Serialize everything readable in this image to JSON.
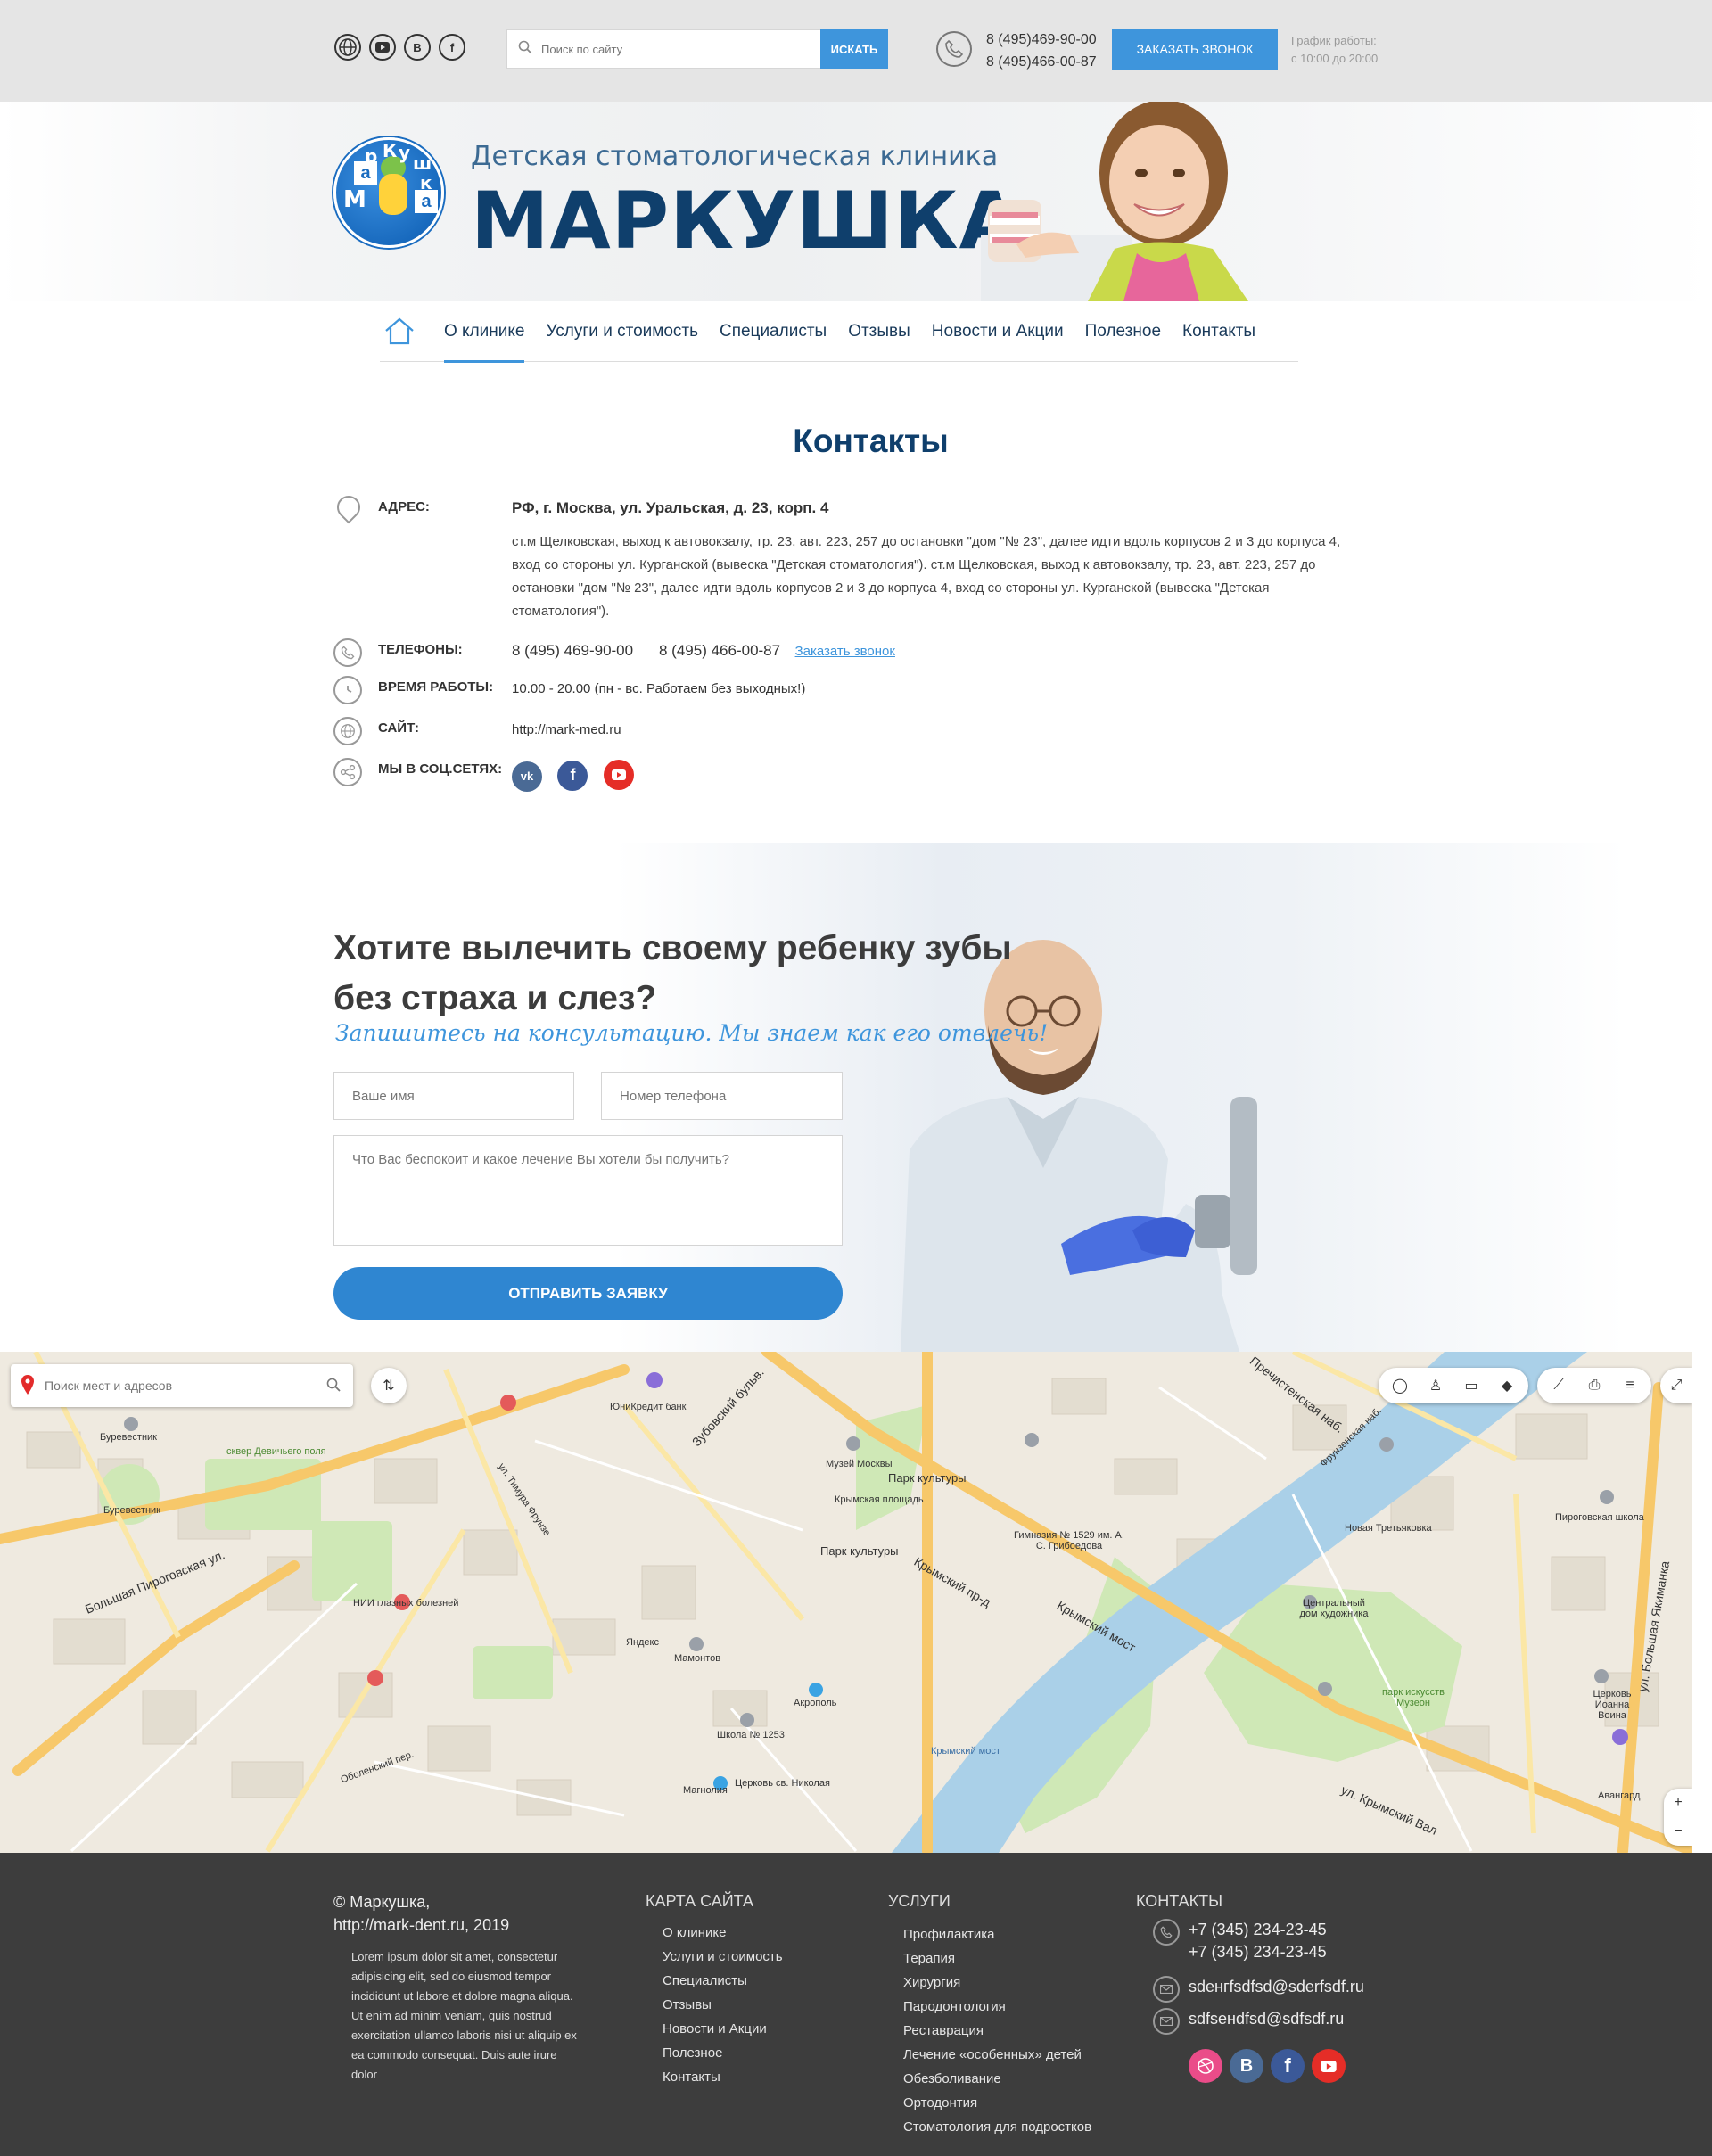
{
  "topbar": {
    "search_placeholder": "Поиск по сайту",
    "search_button": "ИСКАТЬ",
    "phone_1": "8 (495)469-90-00",
    "phone_2": "8 (495)466-00-87",
    "callback_button": "ЗАКАЗАТЬ ЗВОНОК",
    "worktime_label": "График работы:",
    "worktime_value": "с 10:00 до 20:00",
    "social_icons": [
      "globe-icon",
      "youtube-icon",
      "vk-icon",
      "facebook-icon"
    ],
    "vk_letter": "В",
    "fb_letter": "f"
  },
  "header": {
    "logo_letters": [
      "М",
      "а",
      "р",
      "К",
      "у",
      "ш",
      "к",
      "а"
    ],
    "subtitle": "Детская стоматологическая клиника",
    "title": "МАРКУШКА"
  },
  "nav": {
    "items": [
      "О клинике",
      "Услуги и стоимость",
      "Специалисты",
      "Отзывы",
      "Новости и Акции",
      "Полезное",
      "Контакты"
    ],
    "active": "О клинике"
  },
  "contacts": {
    "title": "Контакты",
    "address_label": "АДРЕС:",
    "address": "РФ, г. Москва, ул. Уральская, д. 23, корп. 4",
    "address_description": "ст.м Щелковская, выход к автовокзалу, тр. 23, авт. 223, 257 до остановки \"дом \"№ 23\", далее идти вдоль корпусов 2 и 3 до корпуса 4, вход со стороны ул. Курганской (вывеска \"Детская стоматология\"). ст.м Щелковская, выход к автовокзалу, тр. 23, авт. 223, 257 до остановки \"дом \"№ 23\", далее идти вдоль корпусов 2 и 3 до корпуса 4, вход со стороны ул. Курганской (вывеска \"Детская стоматология\").",
    "phones_label": "ТЕЛЕФОНЫ:",
    "phone_1": "8 (495) 469-90-00",
    "phone_2": "8 (495) 466-00-87",
    "callback_link": "Заказать звонок",
    "hours_label": "ВРЕМЯ РАБОТЫ:",
    "hours": "10.00 - 20.00 (пн - вс. Работаем без выходных!)",
    "site_label": "САЙТ:",
    "site": "http://mark-med.ru",
    "social_label": "МЫ В СОЦ.СЕТЯХ:",
    "social_vk": "vk",
    "social_fb": "f",
    "colors": {
      "vk": "#4a6a95",
      "facebook": "#3b5998",
      "youtube": "#e52d27",
      "accent": "#3e95dc"
    }
  },
  "form": {
    "title_line1": "Хотите вылечить своему ребенку зубы",
    "title_line2": "без страха и слез?",
    "subtitle": "Запишитесь на консультацию. Мы знаем как его отвлечь!",
    "name_placeholder": "Ваше имя",
    "phone_placeholder": "Номер телефона",
    "message_placeholder": "Что Вас беспокоит и какое лечение Вы хотели бы получить?",
    "submit": "ОТПРАВИТЬ ЗАЯВКУ"
  },
  "map": {
    "search_placeholder": "Поиск мест и адресов",
    "labels": [
      "ЮниКредит банк",
      "Буревестник",
      "сквер Девичьего поля",
      "Буревестник",
      "Музей Москвы",
      "Парк культуры",
      "Крымская площадь",
      "Парк культуры",
      "Гимназия № 1529 им. А. С. Грибоедова",
      "Новая Третьяковка",
      "Пироговская школа",
      "Центральный дом художника",
      "НИИ глазных болезней",
      "Яндекс",
      "Мамонтов",
      "Акрополь",
      "Школа № 1253",
      "Магнолия",
      "Церковь св. Николая",
      "Крымский мост",
      "парк искусств Музеон",
      "Церковь Иоанна Воина",
      "Авангард"
    ],
    "streets": [
      "Зубовский бульв.",
      "Крымский пр-д",
      "Крымский мост",
      "ул. Крымский Вал",
      "Пречистенская наб.",
      "Фрунзенская наб.",
      "ул. Большая Якиманка",
      "Большая Пироговская ул.",
      "ул. Тимура Фрунзе",
      "Оболенский пер."
    ]
  },
  "footer": {
    "copyright_line1": "© Маркушка,",
    "copyright_line2": "http://mark-dent.ru, 2019",
    "lorem": "Lorem ipsum dolor sit amet, consectetur adipisicing elit, sed do eiusmod tempor incididunt ut labore et dolore magna aliqua. Ut enim ad minim veniam, quis nostrud exercitation ullamco laboris nisi ut aliquip ex ea commodo consequat. Duis aute irure dolor",
    "sitemap_title": "КАРТА САЙТА",
    "sitemap": [
      "О клинике",
      "Услуги и стоимость",
      "Специалисты",
      "Отзывы",
      "Новости и Акции",
      "Полезное",
      "Контакты"
    ],
    "services_title": "УСЛУГИ",
    "services": [
      "Профилактика",
      "Терапия",
      "Хирургия",
      "Пародонтология",
      "Реставрация",
      "Лечение «особенных» детей",
      "Обезболивание",
      "Ортодонтия",
      "Стоматология для подростков"
    ],
    "contacts_title": "КОНТАКТЫ",
    "phone_1": "+7 (345) 234-23-45",
    "phone_2": "+7 (345) 234-23-45",
    "email_1": "sdeнгfsdfsd@sderfsdf.ru",
    "email_2": "sdfsенdfsd@sdfsdf.ru",
    "social": [
      "dribbble-icon",
      "vk-icon",
      "facebook-icon",
      "youtube-icon"
    ],
    "vk_letter": "В",
    "fb_letter": "f"
  }
}
